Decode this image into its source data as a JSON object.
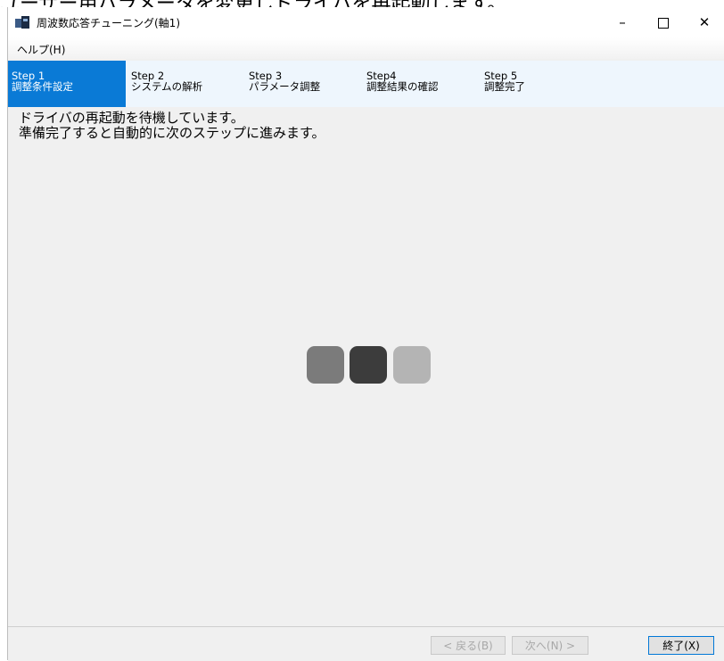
{
  "window": {
    "title": "周波数応答チューニング(軸1)",
    "controls": {
      "minimize": "–",
      "maximize": "",
      "close": "✕"
    }
  },
  "menu": {
    "help_label": "ヘルプ(H)"
  },
  "steps": [
    {
      "num": "Step 1",
      "label": "調整条件設定",
      "active": true
    },
    {
      "num": "Step 2",
      "label": "システムの解析",
      "active": false
    },
    {
      "num": "Step 3",
      "label": "パラメータ調整",
      "active": false
    },
    {
      "num": "Step4",
      "label": "調整結果の確認",
      "active": false
    },
    {
      "num": "Step 5",
      "label": "調整完了",
      "active": false
    }
  ],
  "message": {
    "line1": "ドライバの再起動を待機しています。",
    "line2": "準備完了すると自動的に次のステップに進みます。"
  },
  "buttons": {
    "back": "< 戻る(B)",
    "next": "次へ(N) >",
    "exit": "終了(X)"
  },
  "background_text": "ユーザー用パラメータを変更しドライバを再起動します。",
  "colors": {
    "active_step": "#0a7ad6",
    "stepbar_bg": "#eef6fd",
    "window_bg": "#f0f0f0",
    "spinner": [
      "#7b7b7b",
      "#3c3c3c",
      "#b4b4b4"
    ]
  },
  "icons": {
    "app": "app-window-icon",
    "spinner": "loading-spinner"
  }
}
